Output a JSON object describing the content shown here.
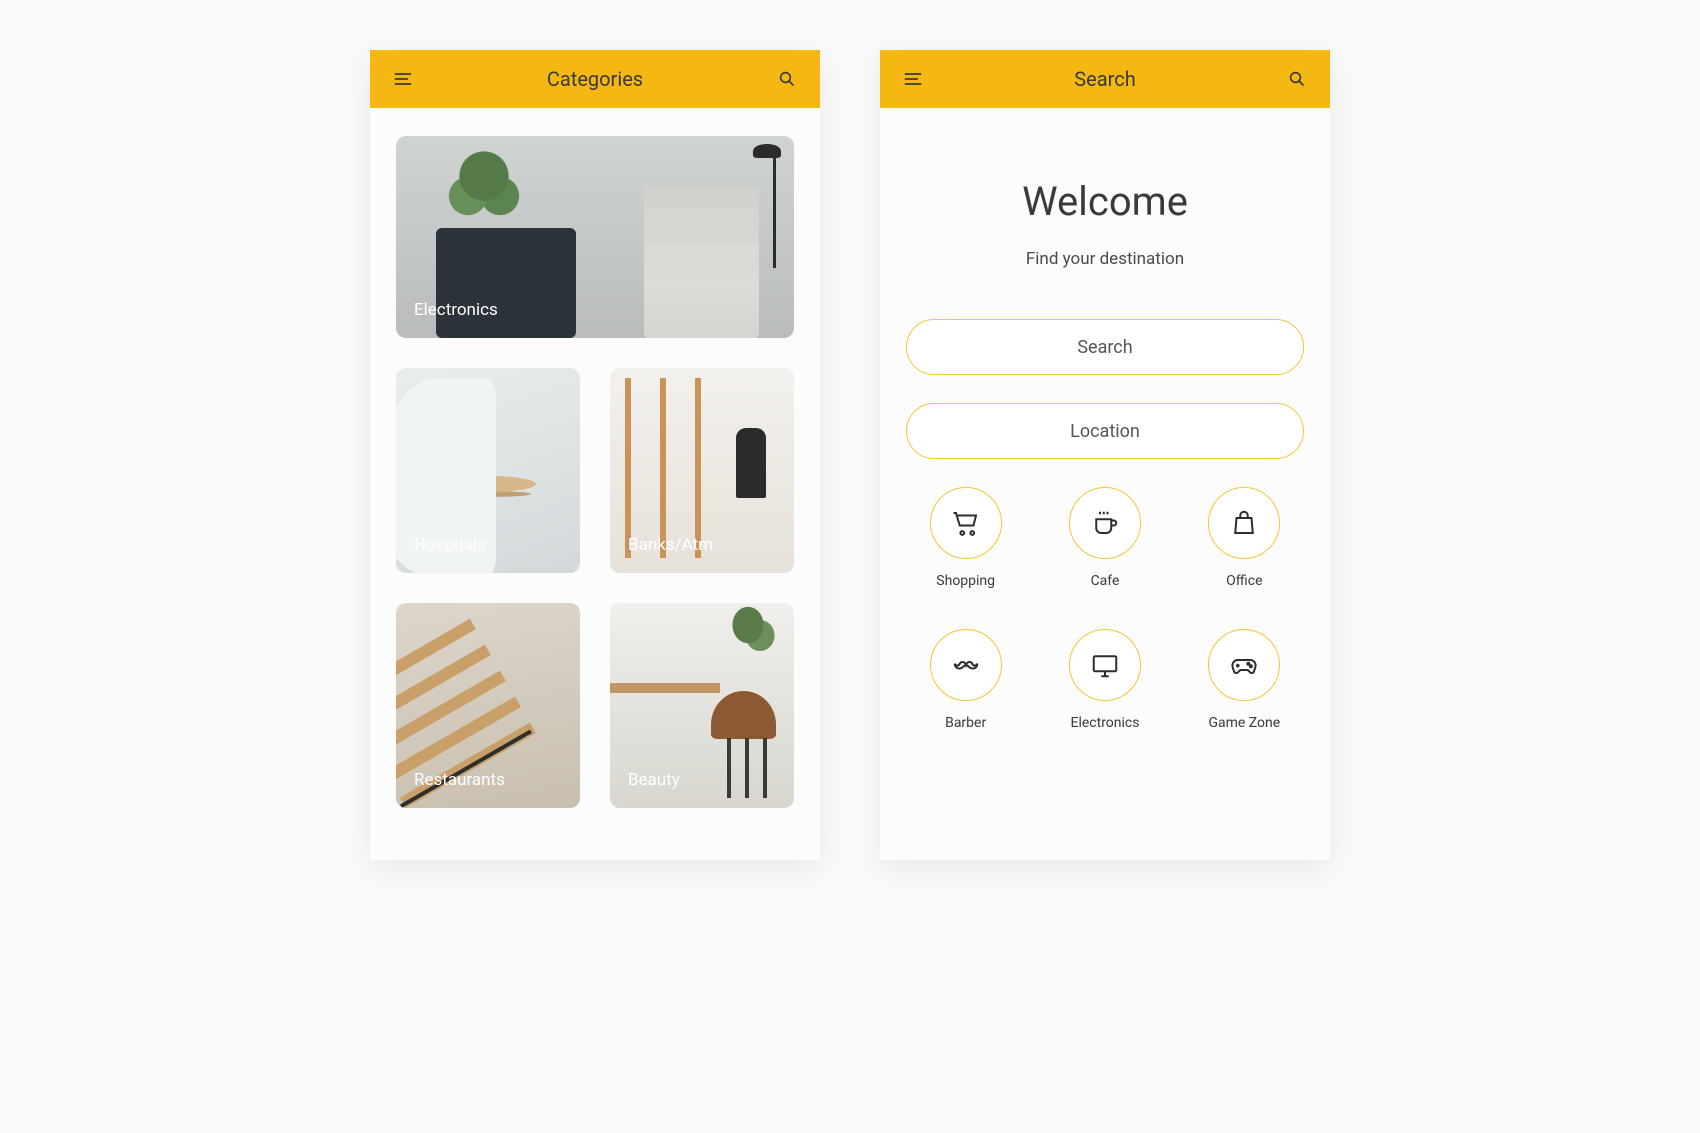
{
  "screens": {
    "categories": {
      "title": "Categories",
      "hero": {
        "label": "Electronics"
      },
      "cards": [
        {
          "label": "Hospitals"
        },
        {
          "label": "Banks/Atm"
        },
        {
          "label": "Restaurants"
        },
        {
          "label": "Beauty"
        }
      ]
    },
    "search": {
      "title": "Search",
      "welcome_heading": "Welcome",
      "welcome_subtitle": "Find your destination",
      "inputs": {
        "search_placeholder": "Search",
        "location_placeholder": "Location"
      },
      "icons": [
        {
          "name": "shopping-cart-icon",
          "label": "Shopping"
        },
        {
          "name": "coffee-cup-icon",
          "label": "Cafe"
        },
        {
          "name": "bag-icon",
          "label": "Office"
        },
        {
          "name": "mustache-icon",
          "label": "Barber"
        },
        {
          "name": "monitor-icon",
          "label": "Electronics"
        },
        {
          "name": "gamepad-icon",
          "label": "Game Zone"
        }
      ]
    }
  },
  "colors": {
    "accent": "#f5b812",
    "outline": "#f2c738",
    "text": "#3a3a3a"
  }
}
